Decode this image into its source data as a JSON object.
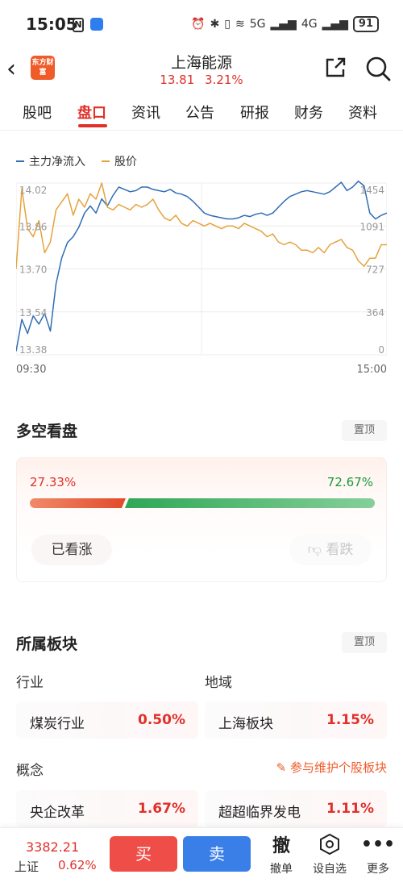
{
  "status_bar": {
    "time": "15:05",
    "network_5g": "5G",
    "network_4g": "4G",
    "battery": "91"
  },
  "header": {
    "logo_text": "东方财富",
    "title": "上海能源",
    "price": "13.81",
    "change_pct": "3.21%"
  },
  "tabs": [
    "股吧",
    "盘口",
    "资讯",
    "公告",
    "研报",
    "财务",
    "资料"
  ],
  "chart": {
    "legend": {
      "main_flow": "主力净流入",
      "price": "股价"
    },
    "colors": {
      "main_flow": "#2f6db5",
      "price": "#e6a23c",
      "grid": "#ececec",
      "axis_text": "#999999"
    }
  },
  "chart_data": {
    "type": "line",
    "x_start": "09:30",
    "x_end": "15:00",
    "left_axis_ticks": [
      "14.02",
      "13.86",
      "13.70",
      "13.54",
      "13.38"
    ],
    "right_axis_ticks": [
      "1454",
      "1091",
      "727",
      "364",
      "0"
    ],
    "ylim_left": [
      13.38,
      14.02
    ],
    "ylim_right": [
      0,
      1454
    ],
    "series": [
      {
        "name": "主力净流入",
        "axis": "right",
        "values": [
          30,
          300,
          180,
          330,
          260,
          350,
          200,
          600,
          820,
          950,
          1000,
          1080,
          1200,
          1260,
          1200,
          1320,
          1260,
          1350,
          1420,
          1400,
          1380,
          1390,
          1420,
          1420,
          1400,
          1390,
          1380,
          1400,
          1370,
          1360,
          1340,
          1300,
          1250,
          1200,
          1180,
          1170,
          1160,
          1150,
          1150,
          1160,
          1180,
          1170,
          1190,
          1200,
          1180,
          1200,
          1250,
          1300,
          1340,
          1360,
          1380,
          1390,
          1380,
          1370,
          1360,
          1380,
          1420,
          1460,
          1390,
          1420,
          1470,
          1430,
          1200,
          1150,
          1180,
          1200
        ]
      },
      {
        "name": "股价",
        "axis": "left",
        "values": [
          13.7,
          14.0,
          13.85,
          13.82,
          13.88,
          13.76,
          13.8,
          13.92,
          13.95,
          13.98,
          13.9,
          13.96,
          13.93,
          13.98,
          13.96,
          14.02,
          13.93,
          13.92,
          13.94,
          13.93,
          13.92,
          13.94,
          13.93,
          13.94,
          13.96,
          13.92,
          13.89,
          13.88,
          13.9,
          13.87,
          13.86,
          13.88,
          13.87,
          13.86,
          13.87,
          13.86,
          13.85,
          13.86,
          13.86,
          13.85,
          13.87,
          13.86,
          13.85,
          13.84,
          13.82,
          13.83,
          13.8,
          13.79,
          13.8,
          13.79,
          13.77,
          13.77,
          13.76,
          13.78,
          13.76,
          13.79,
          13.8,
          13.81,
          13.78,
          13.77,
          13.73,
          13.71,
          13.74,
          13.74,
          13.79,
          13.79
        ]
      }
    ]
  },
  "sentiment": {
    "title": "多空看盘",
    "pin_label": "置顶",
    "bull_pct": "27.33%",
    "bear_pct": "72.67%",
    "bull_fraction": 0.2733,
    "bull_button": "已看涨",
    "bear_button": "看跌"
  },
  "sectors": {
    "title": "所属板块",
    "pin_label": "置顶",
    "industry_label": "行业",
    "region_label": "地域",
    "concept_label": "概念",
    "maintain_link": "参与维护个股板块",
    "industry": {
      "name": "煤炭行业",
      "change": "0.50%"
    },
    "region": {
      "name": "上海板块",
      "change": "1.15%"
    },
    "concepts": [
      {
        "name": "央企改革",
        "change": "1.67%"
      },
      {
        "name": "超超临界发电",
        "change": "1.11%"
      }
    ]
  },
  "bottom_bar": {
    "index_value": "3382.21",
    "index_name": "上证",
    "index_change": "0.62%",
    "buy": "买",
    "sell": "卖",
    "cancel_icon": "撤",
    "cancel_label": "撤单",
    "watchlist_label": "设自选",
    "more_label": "更多"
  }
}
